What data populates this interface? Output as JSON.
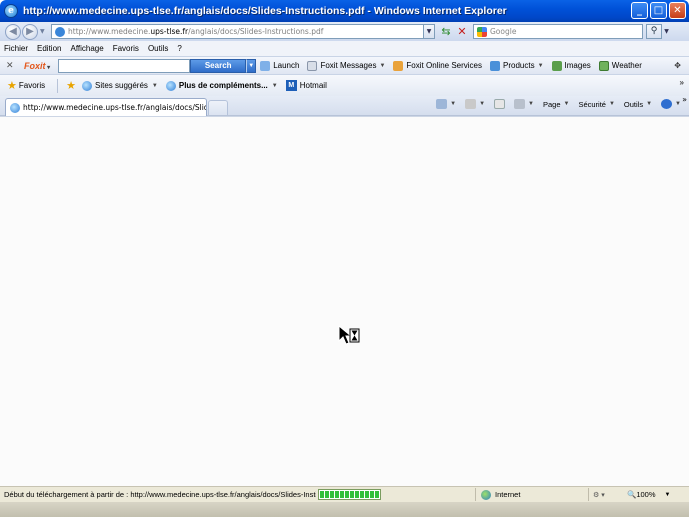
{
  "window": {
    "title": "http://www.medecine.ups-tlse.fr/anglais/docs/Slides-Instructions.pdf - Windows Internet Explorer",
    "buttons": {
      "minimize": "_",
      "maximize": "□",
      "close": "✕"
    }
  },
  "address_bar": {
    "url_prefix": "http://www.medecine.",
    "url_domain": "ups-tlse.fr",
    "url_suffix": "/anglais/docs/Slides-Instructions.pdf",
    "search_placeholder": "Google"
  },
  "menu": [
    "Fichier",
    "Edition",
    "Affichage",
    "Favoris",
    "Outils",
    "?"
  ],
  "foxit_toolbar": {
    "close": "✕",
    "brand": "Foxit",
    "search_value": "",
    "search_button": "Search",
    "items": [
      {
        "label": "Launch",
        "icon": "launch-icon"
      },
      {
        "label": "Foxit Messages",
        "icon": "messages-icon",
        "dropdown": true
      },
      {
        "label": "Foxit Online Services",
        "icon": "online-services-icon"
      },
      {
        "label": "Products",
        "icon": "products-icon",
        "dropdown": true
      },
      {
        "label": "Images",
        "icon": "images-icon"
      },
      {
        "label": "Weather",
        "icon": "weather-icon"
      }
    ]
  },
  "favorites_bar": {
    "favorites_label": "Favoris",
    "items": [
      {
        "label": "Sites suggérés",
        "dropdown": true
      },
      {
        "label": "Plus de compléments...",
        "dropdown": true,
        "bold": true
      },
      {
        "label": "Hotmail",
        "dropdown": false
      }
    ]
  },
  "tab": {
    "title": "http://www.medecine.ups-tlse.fr/anglais/docs/Slides-..."
  },
  "command_bar": {
    "page": "Page",
    "security": "Sécurité",
    "tools": "Outils"
  },
  "status_bar": {
    "message": "Début du téléchargement à partir de : http://www.medecine.ups-tlse.fr/anglais/docs/Slides-Insti",
    "progress": 1.0,
    "zone": "Internet",
    "zoom": "100%"
  },
  "colors": {
    "titlebar": "#0051d8",
    "progress": "#33c03a",
    "content_bg": "#fbfbfb"
  }
}
